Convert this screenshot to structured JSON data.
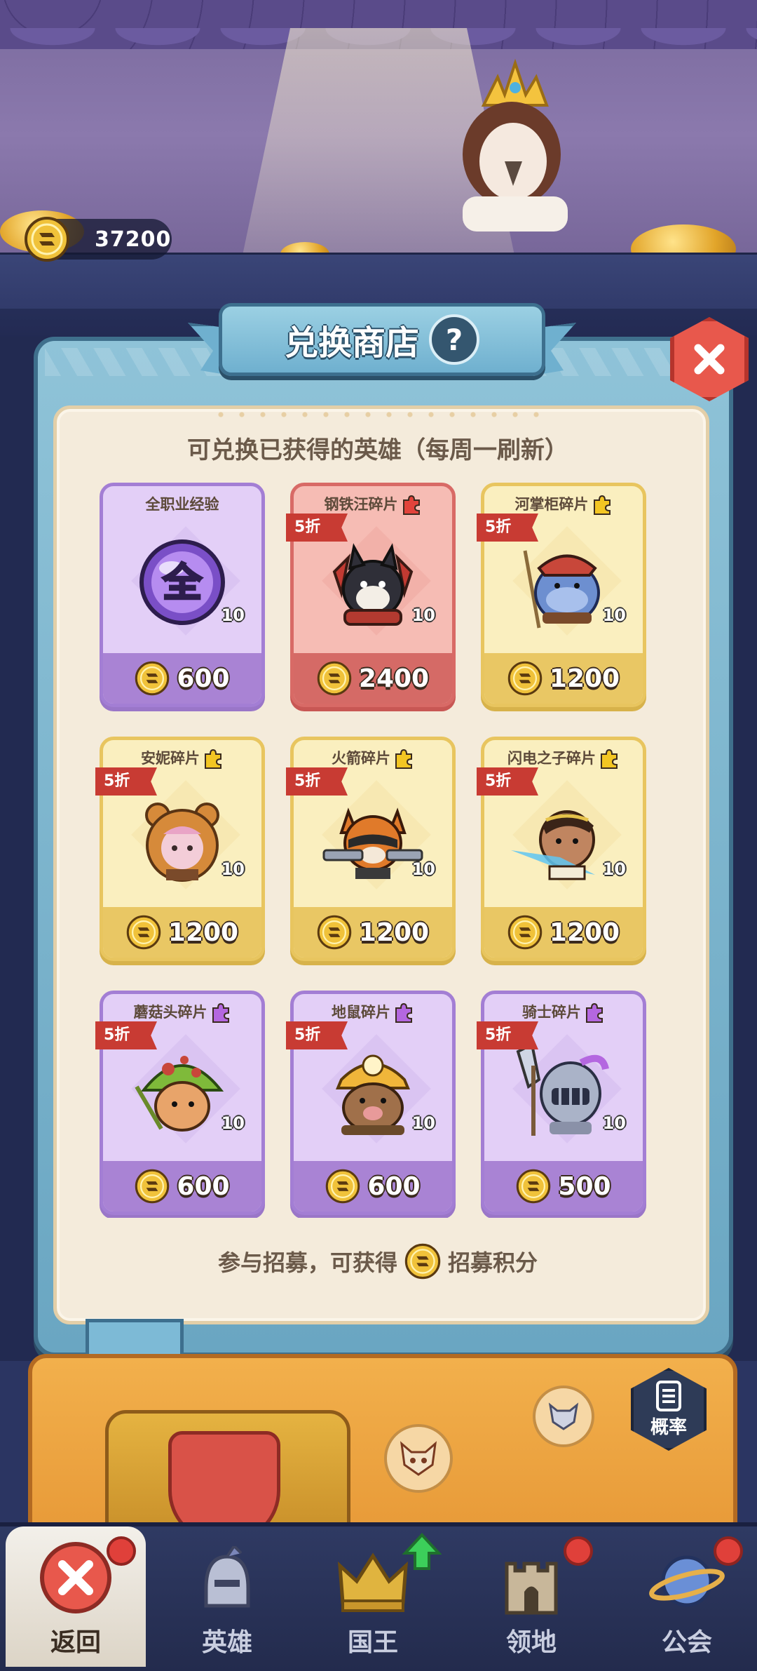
{
  "currency": {
    "amount": "37200"
  },
  "shop": {
    "title": "兑换商店",
    "help": "?",
    "subtitle": "可兑换已获得的英雄（每周一刷新）",
    "recruit_prefix": "参与招募，可获得",
    "recruit_suffix": "招募积分"
  },
  "cards": [
    {
      "name": "全职业经验",
      "qty": "10",
      "price": "600",
      "discount": "",
      "theme": "purple",
      "puzzle_color": "",
      "art": "exp-orb"
    },
    {
      "name": "钢铁汪碎片",
      "qty": "10",
      "price": "2400",
      "discount": "5折",
      "theme": "red",
      "puzzle_color": "#e2433b",
      "art": "dog-hero"
    },
    {
      "name": "河掌柜碎片",
      "qty": "10",
      "price": "1200",
      "discount": "5折",
      "theme": "yellow",
      "puzzle_color": "#f3c623",
      "art": "hippo-hero"
    },
    {
      "name": "安妮碎片",
      "qty": "10",
      "price": "1200",
      "discount": "5折",
      "theme": "yellow",
      "puzzle_color": "#f3c623",
      "art": "bear-girl-hero"
    },
    {
      "name": "火箭碎片",
      "qty": "10",
      "price": "1200",
      "discount": "5折",
      "theme": "yellow",
      "puzzle_color": "#f3c623",
      "art": "raccoon-hero"
    },
    {
      "name": "闪电之子碎片",
      "qty": "10",
      "price": "1200",
      "discount": "5折",
      "theme": "yellow",
      "puzzle_color": "#f3c623",
      "art": "lightning-hero"
    },
    {
      "name": "蘑菇头碎片",
      "qty": "10",
      "price": "600",
      "discount": "5折",
      "theme": "purple",
      "puzzle_color": "#b467e0",
      "art": "mushroom-hero"
    },
    {
      "name": "地鼠碎片",
      "qty": "10",
      "price": "600",
      "discount": "5折",
      "theme": "purple",
      "puzzle_color": "#b467e0",
      "art": "mole-hero"
    },
    {
      "name": "骑士碎片",
      "qty": "10",
      "price": "500",
      "discount": "5折",
      "theme": "purple",
      "puzzle_color": "#b467e0",
      "art": "knight-hero"
    }
  ],
  "exp_orb_char": "全",
  "rate_button": {
    "label": "概率"
  },
  "nav": [
    {
      "label": "返回",
      "icon": "close-icon",
      "active": true,
      "badge": true
    },
    {
      "label": "英雄",
      "icon": "helmet-icon",
      "active": false,
      "badge": false
    },
    {
      "label": "国王",
      "icon": "crown-icon",
      "active": false,
      "badge": false,
      "upgrade": true
    },
    {
      "label": "领地",
      "icon": "castle-icon",
      "active": false,
      "badge": true
    },
    {
      "label": "公会",
      "icon": "planet-icon",
      "active": false,
      "badge": true
    }
  ],
  "colors": {
    "discount_red": "#c83b33",
    "purple_card": "#e3cff7",
    "red_card": "#f6bcb4",
    "yellow_card": "#faefbf",
    "panel_blue": "#6aa6c2"
  }
}
